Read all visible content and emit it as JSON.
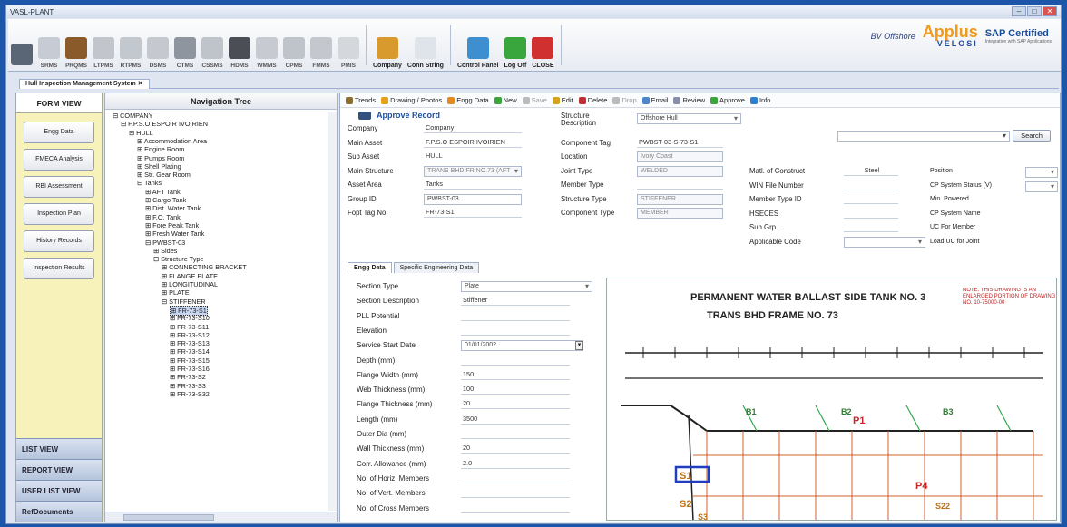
{
  "window": {
    "title": "VASL-PLANT"
  },
  "toolbar": {
    "buttons": [
      {
        "label": "",
        "icon": "logo-icon",
        "color": "#5a6575"
      },
      {
        "label": "SRMS",
        "icon": "chart-icon",
        "color": "#c7ccd4"
      },
      {
        "label": "PRQMS",
        "icon": "fittings-icon",
        "color": "#8a5a2a"
      },
      {
        "label": "LTPMS",
        "icon": "gear-icon",
        "color": "#c2c6cc"
      },
      {
        "label": "RTPMS",
        "icon": "crane-icon",
        "color": "#c3c7ce"
      },
      {
        "label": "DSMS",
        "icon": "pipe-icon",
        "color": "#c5c9cf"
      },
      {
        "label": "CTMS",
        "icon": "plant-icon",
        "color": "#8e959f"
      },
      {
        "label": "CSSMS",
        "icon": "tower-icon",
        "color": "#bfc4cb"
      },
      {
        "label": "HDMS",
        "icon": "box-icon",
        "color": "#4b4e55"
      },
      {
        "label": "WMMS",
        "icon": "structure-icon",
        "color": "#c7cbd1"
      },
      {
        "label": "CPMS",
        "icon": "panel-icon",
        "color": "#bfc4cb"
      },
      {
        "label": "FMMS",
        "icon": "plate-icon",
        "color": "#c4c8ce"
      },
      {
        "label": "PMIS",
        "icon": "report-icon",
        "color": "#d4d7dc"
      },
      {
        "label": "Company",
        "icon": "home-icon",
        "color": "#d89a2c"
      },
      {
        "label": "Conn String",
        "icon": "monitor-icon",
        "color": "#dfe3ea"
      },
      {
        "label": "Control Panel",
        "icon": "control-icon",
        "color": "#3d8fd0"
      },
      {
        "label": "Log Off",
        "icon": "power-icon",
        "color": "#39a53d"
      },
      {
        "label": "CLOSE",
        "icon": "stop-icon",
        "color": "#d03030"
      }
    ],
    "brand": {
      "bv": "BV Offshore",
      "applus": "Applus",
      "velosi": "VELOSI",
      "sap": "SAP Certified",
      "sap_sub": "Integration with SAP Applications"
    }
  },
  "tabs": {
    "active": "Hull Inspection Management System ✕"
  },
  "leftnav": {
    "header": "FORM VIEW",
    "buttons": [
      "Engg Data",
      "FMECA Analysis",
      "RBI Assessment",
      "Inspection Plan",
      "History Records",
      "Inspection Results"
    ],
    "bottom": [
      "LIST VIEW",
      "REPORT VIEW",
      "USER LIST VIEW",
      "RefDocuments"
    ]
  },
  "tree": {
    "header": "Navigation Tree",
    "nodes": [
      {
        "t": "⊟ COMPANY",
        "l": 0
      },
      {
        "t": "⊟ F.P.S.O ESPOIR IVOIRIEN",
        "l": 1
      },
      {
        "t": "⊟ HULL",
        "l": 2
      },
      {
        "t": "⊞ Accommodation Area",
        "l": 3
      },
      {
        "t": "⊞ Engine Room",
        "l": 3
      },
      {
        "t": "⊞ Pumps Room",
        "l": 3
      },
      {
        "t": "⊞ Shell Plating",
        "l": 3
      },
      {
        "t": "⊞ Str. Gear Room",
        "l": 3
      },
      {
        "t": "⊟ Tanks",
        "l": 3
      },
      {
        "t": "⊞ AFT Tank",
        "l": 4
      },
      {
        "t": "⊞ Cargo Tank",
        "l": 4
      },
      {
        "t": "⊞ Dist. Water Tank",
        "l": 4
      },
      {
        "t": "⊞ F.O. Tank",
        "l": 4
      },
      {
        "t": "⊞ Fore Peak Tank",
        "l": 4
      },
      {
        "t": "⊞ Fresh Water Tank",
        "l": 4
      },
      {
        "t": "⊟ PWBST-03",
        "l": 4
      },
      {
        "t": "⊞ Sides",
        "l": 5
      },
      {
        "t": "⊟ Structure Type",
        "l": 5
      },
      {
        "t": "⊞ CONNECTING BRACKET",
        "l": 6
      },
      {
        "t": "⊞ FLANGE PLATE",
        "l": 6
      },
      {
        "t": "⊞ LONGITUDINAL",
        "l": 6
      },
      {
        "t": "⊞ PLATE",
        "l": 6
      },
      {
        "t": "⊟ STIFFENER",
        "l": 6
      },
      {
        "t": "⊞ FR-73-S1",
        "l": 7,
        "sel": true
      },
      {
        "t": "⊞ FR-73-S10",
        "l": 7
      },
      {
        "t": "⊞ FR-73-S11",
        "l": 7
      },
      {
        "t": "⊞ FR-73-S12",
        "l": 7
      },
      {
        "t": "⊞ FR-73-S13",
        "l": 7
      },
      {
        "t": "⊞ FR-73-S14",
        "l": 7
      },
      {
        "t": "⊞ FR-73-S15",
        "l": 7
      },
      {
        "t": "⊞ FR-73-S16",
        "l": 7
      },
      {
        "t": "⊞ FR-73-S2",
        "l": 7
      },
      {
        "t": "⊞ FR-73-S3",
        "l": 7
      },
      {
        "t": "⊞ FR-73-S32",
        "l": 7
      }
    ]
  },
  "actions": [
    {
      "label": "Trends",
      "color": "#8a6f2e",
      "dis": false
    },
    {
      "label": "Drawing / Photos",
      "color": "#e7a019",
      "dis": false
    },
    {
      "label": "Engg Data",
      "color": "#e58a1f",
      "dis": false
    },
    {
      "label": "New",
      "color": "#3aa53a",
      "dis": false
    },
    {
      "label": "Save",
      "color": "#bbbbbb",
      "dis": true
    },
    {
      "label": "Edit",
      "color": "#d6a320",
      "dis": false
    },
    {
      "label": "Delete",
      "color": "#c03030",
      "dis": false
    },
    {
      "label": "Drop",
      "color": "#bbbbbb",
      "dis": true
    },
    {
      "label": "Email",
      "color": "#4a86c8",
      "dis": false
    },
    {
      "label": "Review",
      "color": "#8a8fa8",
      "dis": false
    },
    {
      "label": "Approve",
      "color": "#3aa53a",
      "dis": false
    },
    {
      "label": "Info",
      "color": "#2f7fd0",
      "dis": false
    }
  ],
  "record": {
    "title": "Approve Record",
    "left": [
      {
        "label": "Company",
        "value": "Company"
      },
      {
        "label": "Main Asset",
        "value": "F.P.S.O ESPOIR IVOIRIEN"
      },
      {
        "label": "Sub Asset",
        "value": "HULL"
      },
      {
        "label": "Main Structure",
        "value": "TRANS BHD FR.NO.73 (AFT"
      },
      {
        "label": "Asset Area",
        "value": "Tanks"
      },
      {
        "label": "Group ID",
        "value": "PWBST-03"
      },
      {
        "label": "Fopt Tag No.",
        "value": "FR-73-S1"
      }
    ],
    "middle": [
      {
        "label": "Structure Description",
        "value": "Offshore Hull"
      },
      {
        "label": "Component Tag",
        "value": "PWBST-03-S-73-S1"
      },
      {
        "label": "Location",
        "value": "Ivory Coast"
      },
      {
        "label": "Joint Type",
        "value": "WELDED"
      },
      {
        "label": "Member Type",
        "value": ""
      },
      {
        "label": "Structure Type",
        "value": "STIFFENER"
      },
      {
        "label": "Component Type",
        "value": "MEMBER"
      }
    ],
    "right": [
      {
        "label": "Matl. of Construct",
        "value": "Steel"
      },
      {
        "label": "WIN File Number",
        "value": ""
      },
      {
        "label": "Member Type ID",
        "value": ""
      },
      {
        "label": "HSECES",
        "value": ""
      },
      {
        "label": "Sub Grp.",
        "value": ""
      },
      {
        "label": "Applicable Code",
        "value": ""
      }
    ],
    "far": [
      "Position",
      "CP System Status (V)",
      "Min. Powered",
      "CP System Name",
      "UC For Member",
      "Load UC for Joint"
    ],
    "search": "Search"
  },
  "subtabs": [
    "Engg Data",
    "Specific Engineering Data"
  ],
  "engg": [
    {
      "label": "Section Type",
      "value": "Plate"
    },
    {
      "label": "Section Description",
      "value": "Stiffener"
    },
    {
      "label": "PLL Potential",
      "value": ""
    },
    {
      "label": "Elevation",
      "value": ""
    },
    {
      "label": "Service Start Date",
      "value": "01/01/2002"
    },
    {
      "label": "Depth (mm)",
      "value": ""
    },
    {
      "label": "Flange Width (mm)",
      "value": "150"
    },
    {
      "label": "Web Thickness (mm)",
      "value": "100"
    },
    {
      "label": "Flange Thickness (mm)",
      "value": "20"
    },
    {
      "label": "Length (mm)",
      "value": "3500"
    },
    {
      "label": "Outer Dia (mm)",
      "value": ""
    },
    {
      "label": "Wall Thickness (mm)",
      "value": "20"
    },
    {
      "label": "Corr. Allowance (mm)",
      "value": "2.0"
    },
    {
      "label": "No. of Horiz. Members",
      "value": ""
    },
    {
      "label": "No. of Vert. Members",
      "value": ""
    },
    {
      "label": "No. of Cross Members",
      "value": ""
    }
  ],
  "drawing": {
    "title1": "PERMANENT WATER BALLAST SIDE TANK NO. 3",
    "title2": "TRANS BHD FRAME NO. 73",
    "note": "NOTE: THIS DRAWING IS AN ENLARGED PORTION OF DRAWING NO. 10-75000-00",
    "labels": [
      "P1",
      "B1",
      "B2",
      "B3",
      "P4",
      "S1",
      "S2",
      "S3",
      "S22"
    ]
  }
}
